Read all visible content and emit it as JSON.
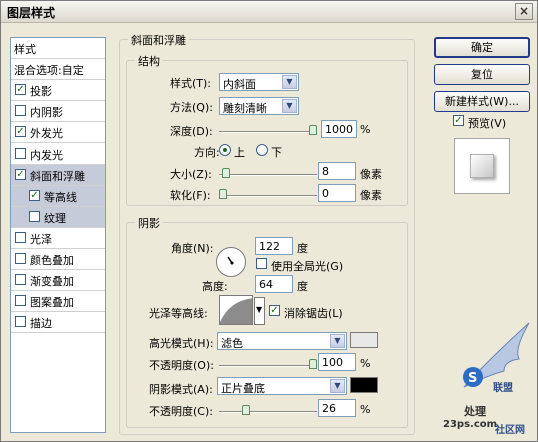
{
  "window": {
    "title": "图层样式",
    "close_glyph": "×"
  },
  "style_list": {
    "items": [
      {
        "label": "样式",
        "kind": "header"
      },
      {
        "label": "混合选项:自定",
        "kind": "header"
      },
      {
        "label": "投影",
        "checked": true
      },
      {
        "label": "内阴影",
        "checked": false
      },
      {
        "label": "外发光",
        "checked": true
      },
      {
        "label": "内发光",
        "checked": false
      },
      {
        "label": "斜面和浮雕",
        "checked": true,
        "selected": true
      },
      {
        "label": "等高线",
        "checked": true,
        "sub": true
      },
      {
        "label": "纹理",
        "checked": false,
        "sub": true
      },
      {
        "label": "光泽",
        "checked": false
      },
      {
        "label": "颜色叠加",
        "checked": false
      },
      {
        "label": "渐变叠加",
        "checked": false
      },
      {
        "label": "图案叠加",
        "checked": false
      },
      {
        "label": "描边",
        "checked": false
      }
    ]
  },
  "bevel": {
    "group_title": "斜面和浮雕",
    "structure": {
      "title": "结构",
      "style_label": "样式(T):",
      "style_value": "内斜面",
      "technique_label": "方法(Q):",
      "technique_value": "雕刻清晰",
      "depth_label": "深度(D):",
      "depth_value": "1000",
      "depth_unit": "%",
      "depth_level": 1.0,
      "direction_label": "方向:",
      "direction_up": "上",
      "direction_down": "下",
      "direction_selected": "上",
      "size_label": "大小(Z):",
      "size_value": "8",
      "size_unit": "像素",
      "size_level": 0.03,
      "soften_label": "软化(F):",
      "soften_value": "0",
      "soften_unit": "像素",
      "soften_level": 0.0
    },
    "shading": {
      "title": "阴影",
      "angle_label": "角度(N):",
      "angle_value": "122",
      "angle_unit": "度",
      "global_light_label": "使用全局光(G)",
      "global_light_checked": false,
      "altitude_label": "高度:",
      "altitude_value": "64",
      "altitude_unit": "度",
      "gloss_label": "光泽等高线:",
      "antialias_label": "消除锯齿(L)",
      "antialias_checked": true,
      "highlight_mode_label": "高光模式(H):",
      "highlight_mode_value": "滤色",
      "highlight_color": "#e8e8e8",
      "highlight_opacity_label": "不透明度(O):",
      "highlight_opacity_value": "100",
      "highlight_opacity_unit": "%",
      "highlight_opacity_level": 1.0,
      "shadow_mode_label": "阴影模式(A):",
      "shadow_mode_value": "正片叠底",
      "shadow_color": "#000000",
      "shadow_opacity_label": "不透明度(C):",
      "shadow_opacity_value": "26",
      "shadow_opacity_unit": "%",
      "shadow_opacity_level": 0.26
    }
  },
  "buttons": {
    "ok": "确定",
    "reset": "复位",
    "new_style": "新建样式(W)...",
    "preview_label": "预览(V)",
    "preview_checked": true
  },
  "watermark": {
    "text1": "处理",
    "text2": "23ps.com",
    "text3": "联盟",
    "text4": "社区网"
  },
  "check_glyph": "✓",
  "arrow_glyph": "▼"
}
